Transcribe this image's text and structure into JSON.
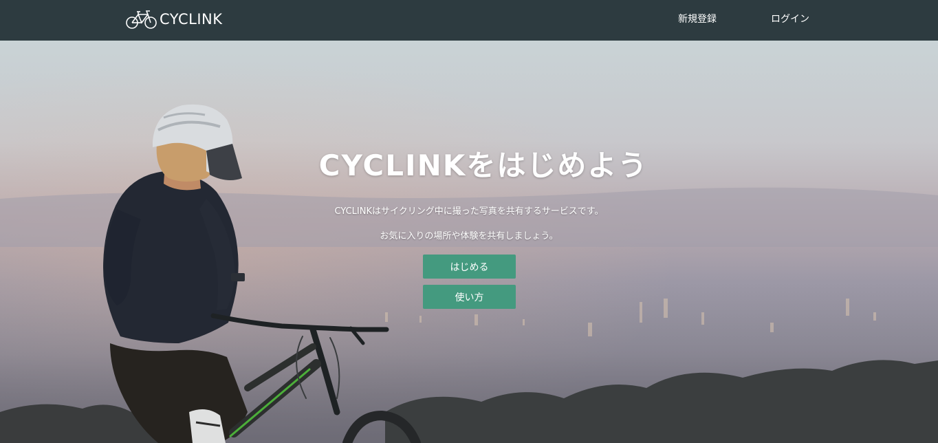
{
  "header": {
    "brand": "CYCLINK",
    "nav": {
      "signup": "新規登録",
      "login": "ログイン"
    }
  },
  "hero": {
    "title": "CYCLINKをはじめよう",
    "description_line1": "CYCLINKはサイクリング中に撮った写真を共有するサービスです。",
    "description_line2": "お気に入りの場所や体験を共有しましょう。",
    "buttons": {
      "start": "はじめる",
      "howto": "使い方"
    }
  },
  "colors": {
    "navbar": "#2d3b40",
    "button": "#449a7f",
    "text": "#ffffff"
  },
  "icons": {
    "logo": "bicycle-icon"
  }
}
